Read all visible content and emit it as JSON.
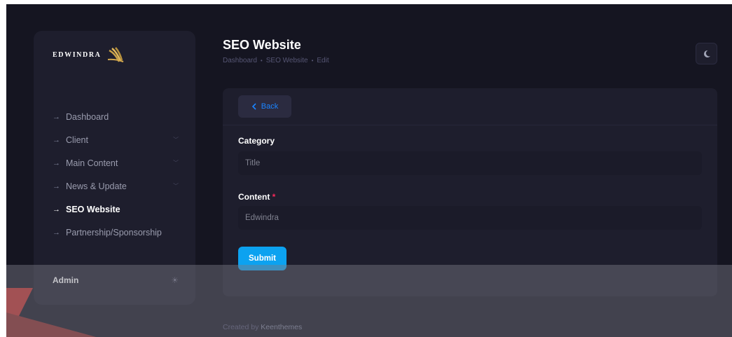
{
  "brand": {
    "name": "EDWINDRA"
  },
  "sidebar": {
    "items": [
      {
        "label": "Dashboard",
        "chevron": false,
        "active": false
      },
      {
        "label": "Client",
        "chevron": true,
        "active": false
      },
      {
        "label": "Main Content",
        "chevron": true,
        "active": false
      },
      {
        "label": "News & Update",
        "chevron": true,
        "active": false
      },
      {
        "label": "SEO Website",
        "chevron": false,
        "active": true
      },
      {
        "label": "Partnership/Sponsorship",
        "chevron": false,
        "active": false
      }
    ],
    "user": "Admin"
  },
  "header": {
    "title": "SEO Website",
    "breadcrumb": [
      "Dashboard",
      "SEO Website",
      "Edit"
    ]
  },
  "form": {
    "back_label": "Back",
    "category_label": "Category",
    "category_value": "Title",
    "content_label": "Content",
    "content_required": "*",
    "content_value": "Edwindra",
    "submit_label": "Submit"
  },
  "footer": {
    "prefix": "Created by",
    "brand": "Keenthemes"
  },
  "colors": {
    "accent": "#1b84ff",
    "submit": "#0ca2f0",
    "background": "#151521",
    "panel": "#1e1e2d"
  },
  "icons": [
    "arrow-right-icon",
    "chevron-down-icon",
    "chevron-left-icon",
    "moon-icon",
    "sun-icon",
    "wheat-logo-icon"
  ]
}
